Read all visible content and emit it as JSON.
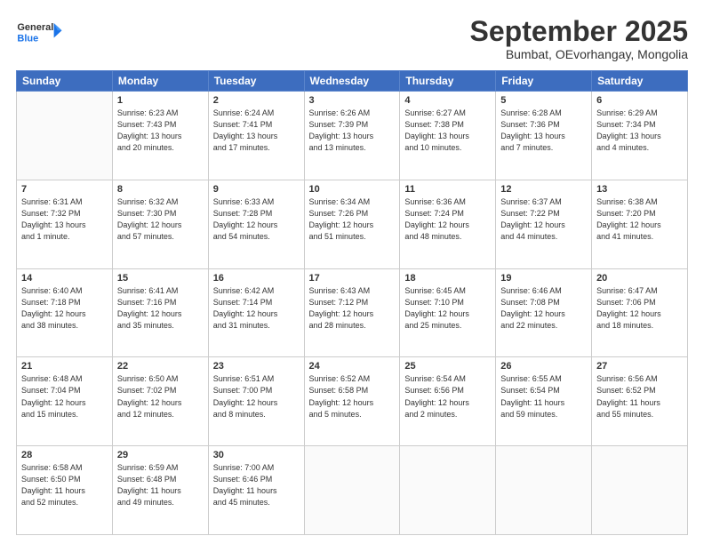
{
  "header": {
    "logo_general": "General",
    "logo_blue": "Blue",
    "month_title": "September 2025",
    "subtitle": "Bumbat, OEvorhangay, Mongolia"
  },
  "weekdays": [
    "Sunday",
    "Monday",
    "Tuesday",
    "Wednesday",
    "Thursday",
    "Friday",
    "Saturday"
  ],
  "weeks": [
    [
      {
        "day": "",
        "info": ""
      },
      {
        "day": "1",
        "info": "Sunrise: 6:23 AM\nSunset: 7:43 PM\nDaylight: 13 hours\nand 20 minutes."
      },
      {
        "day": "2",
        "info": "Sunrise: 6:24 AM\nSunset: 7:41 PM\nDaylight: 13 hours\nand 17 minutes."
      },
      {
        "day": "3",
        "info": "Sunrise: 6:26 AM\nSunset: 7:39 PM\nDaylight: 13 hours\nand 13 minutes."
      },
      {
        "day": "4",
        "info": "Sunrise: 6:27 AM\nSunset: 7:38 PM\nDaylight: 13 hours\nand 10 minutes."
      },
      {
        "day": "5",
        "info": "Sunrise: 6:28 AM\nSunset: 7:36 PM\nDaylight: 13 hours\nand 7 minutes."
      },
      {
        "day": "6",
        "info": "Sunrise: 6:29 AM\nSunset: 7:34 PM\nDaylight: 13 hours\nand 4 minutes."
      }
    ],
    [
      {
        "day": "7",
        "info": "Sunrise: 6:31 AM\nSunset: 7:32 PM\nDaylight: 13 hours\nand 1 minute."
      },
      {
        "day": "8",
        "info": "Sunrise: 6:32 AM\nSunset: 7:30 PM\nDaylight: 12 hours\nand 57 minutes."
      },
      {
        "day": "9",
        "info": "Sunrise: 6:33 AM\nSunset: 7:28 PM\nDaylight: 12 hours\nand 54 minutes."
      },
      {
        "day": "10",
        "info": "Sunrise: 6:34 AM\nSunset: 7:26 PM\nDaylight: 12 hours\nand 51 minutes."
      },
      {
        "day": "11",
        "info": "Sunrise: 6:36 AM\nSunset: 7:24 PM\nDaylight: 12 hours\nand 48 minutes."
      },
      {
        "day": "12",
        "info": "Sunrise: 6:37 AM\nSunset: 7:22 PM\nDaylight: 12 hours\nand 44 minutes."
      },
      {
        "day": "13",
        "info": "Sunrise: 6:38 AM\nSunset: 7:20 PM\nDaylight: 12 hours\nand 41 minutes."
      }
    ],
    [
      {
        "day": "14",
        "info": "Sunrise: 6:40 AM\nSunset: 7:18 PM\nDaylight: 12 hours\nand 38 minutes."
      },
      {
        "day": "15",
        "info": "Sunrise: 6:41 AM\nSunset: 7:16 PM\nDaylight: 12 hours\nand 35 minutes."
      },
      {
        "day": "16",
        "info": "Sunrise: 6:42 AM\nSunset: 7:14 PM\nDaylight: 12 hours\nand 31 minutes."
      },
      {
        "day": "17",
        "info": "Sunrise: 6:43 AM\nSunset: 7:12 PM\nDaylight: 12 hours\nand 28 minutes."
      },
      {
        "day": "18",
        "info": "Sunrise: 6:45 AM\nSunset: 7:10 PM\nDaylight: 12 hours\nand 25 minutes."
      },
      {
        "day": "19",
        "info": "Sunrise: 6:46 AM\nSunset: 7:08 PM\nDaylight: 12 hours\nand 22 minutes."
      },
      {
        "day": "20",
        "info": "Sunrise: 6:47 AM\nSunset: 7:06 PM\nDaylight: 12 hours\nand 18 minutes."
      }
    ],
    [
      {
        "day": "21",
        "info": "Sunrise: 6:48 AM\nSunset: 7:04 PM\nDaylight: 12 hours\nand 15 minutes."
      },
      {
        "day": "22",
        "info": "Sunrise: 6:50 AM\nSunset: 7:02 PM\nDaylight: 12 hours\nand 12 minutes."
      },
      {
        "day": "23",
        "info": "Sunrise: 6:51 AM\nSunset: 7:00 PM\nDaylight: 12 hours\nand 8 minutes."
      },
      {
        "day": "24",
        "info": "Sunrise: 6:52 AM\nSunset: 6:58 PM\nDaylight: 12 hours\nand 5 minutes."
      },
      {
        "day": "25",
        "info": "Sunrise: 6:54 AM\nSunset: 6:56 PM\nDaylight: 12 hours\nand 2 minutes."
      },
      {
        "day": "26",
        "info": "Sunrise: 6:55 AM\nSunset: 6:54 PM\nDaylight: 11 hours\nand 59 minutes."
      },
      {
        "day": "27",
        "info": "Sunrise: 6:56 AM\nSunset: 6:52 PM\nDaylight: 11 hours\nand 55 minutes."
      }
    ],
    [
      {
        "day": "28",
        "info": "Sunrise: 6:58 AM\nSunset: 6:50 PM\nDaylight: 11 hours\nand 52 minutes."
      },
      {
        "day": "29",
        "info": "Sunrise: 6:59 AM\nSunset: 6:48 PM\nDaylight: 11 hours\nand 49 minutes."
      },
      {
        "day": "30",
        "info": "Sunrise: 7:00 AM\nSunset: 6:46 PM\nDaylight: 11 hours\nand 45 minutes."
      },
      {
        "day": "",
        "info": ""
      },
      {
        "day": "",
        "info": ""
      },
      {
        "day": "",
        "info": ""
      },
      {
        "day": "",
        "info": ""
      }
    ]
  ]
}
